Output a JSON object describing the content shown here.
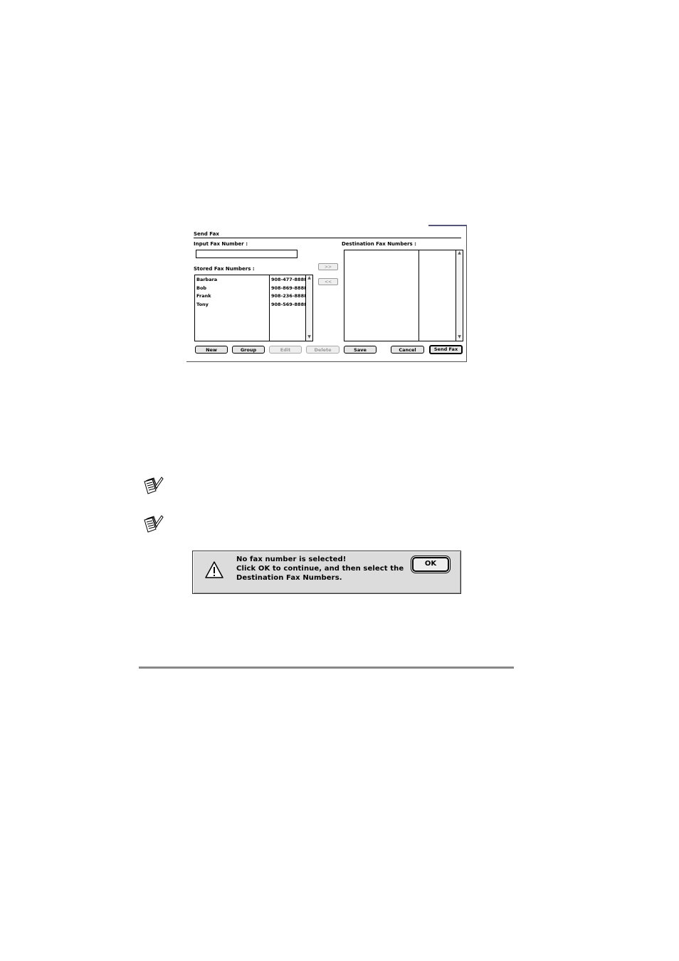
{
  "send_fax_dialog": {
    "title": "Send Fax",
    "input_label": "Input Fax Number :",
    "input_value": "",
    "stored_label": "Stored Fax Numbers :",
    "destination_label": "Destination Fax Numbers :",
    "add_arrow": ">>",
    "remove_arrow": "<<",
    "stored_numbers": [
      {
        "name": "Barbara",
        "number": "908-477-8888"
      },
      {
        "name": "Bob",
        "number": "908-869-8888"
      },
      {
        "name": "Frank",
        "number": "908-236-8888"
      },
      {
        "name": "Tony",
        "number": "908-569-8888"
      }
    ],
    "buttons": {
      "new": "New",
      "group": "Group",
      "edit": "Edit",
      "delete": "Delete",
      "save": "Save",
      "cancel": "Cancel",
      "send_fax": "Send Fax"
    },
    "scroll_up": "▲",
    "scroll_down": "▼"
  },
  "alert": {
    "line1": "No fax number is selected!",
    "line2": "Click OK to continue, and then select the",
    "line3": "Destination Fax Numbers.",
    "ok": "OK"
  },
  "icons": {
    "note_icon_1": "note-pad-pencil-icon",
    "note_icon_2": "note-pad-pencil-icon",
    "alert_icon": "warning-triangle-icon"
  }
}
